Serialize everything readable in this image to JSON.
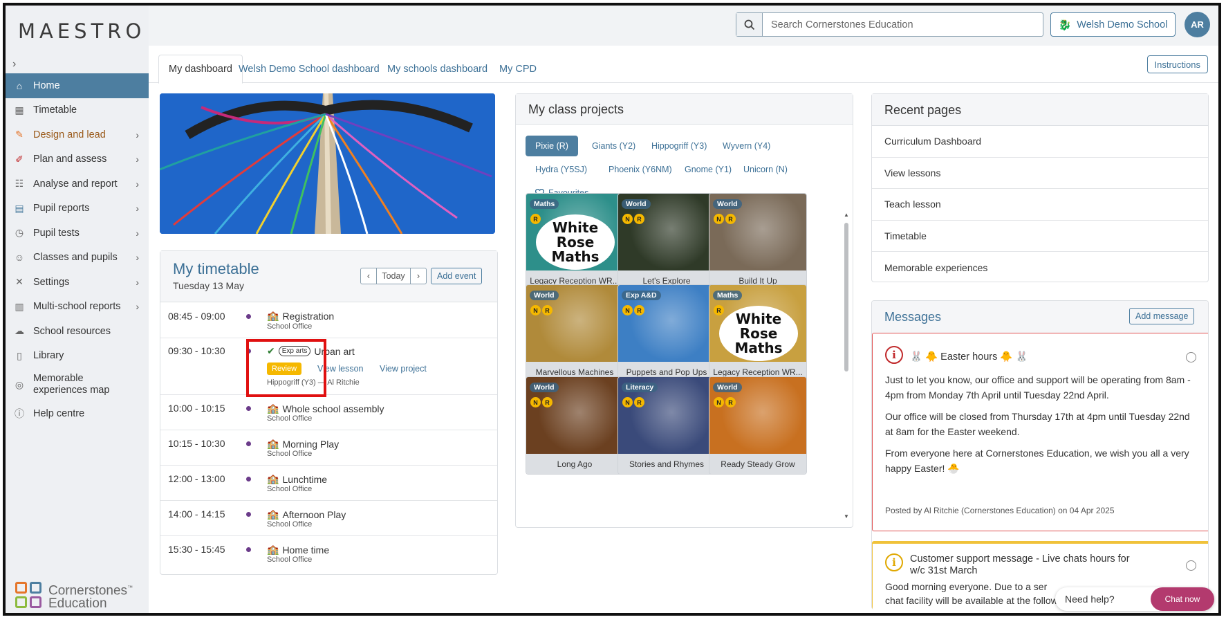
{
  "app": {
    "logo": "MAESTRO",
    "collapse_glyph": "›"
  },
  "sidebar": {
    "items": [
      {
        "label": "Home",
        "icon": "home-icon",
        "glyph": "⌂",
        "active": true,
        "chevron": false
      },
      {
        "label": "Timetable",
        "icon": "calendar-icon",
        "glyph": "▦",
        "chevron": false
      },
      {
        "label": "Design and lead",
        "icon": "design-icon",
        "glyph": "✎",
        "chevron": true
      },
      {
        "label": "Plan and assess",
        "icon": "pencil-icon",
        "glyph": "✐",
        "chevron": true
      },
      {
        "label": "Analyse and report",
        "icon": "chart-icon",
        "glyph": "☷",
        "chevron": true
      },
      {
        "label": "Pupil reports",
        "icon": "report-icon",
        "glyph": "▤",
        "chevron": true
      },
      {
        "label": "Pupil tests",
        "icon": "stopwatch-icon",
        "glyph": "◷",
        "chevron": true
      },
      {
        "label": "Classes and pupils",
        "icon": "people-icon",
        "glyph": "☺",
        "chevron": true
      },
      {
        "label": "Settings",
        "icon": "tools-icon",
        "glyph": "✕",
        "chevron": true
      },
      {
        "label": "Multi-school reports",
        "icon": "buildings-icon",
        "glyph": "▥",
        "chevron": true
      },
      {
        "label": "School resources",
        "icon": "cloud-icon",
        "glyph": "☁",
        "chevron": false
      },
      {
        "label": "Library",
        "icon": "books-icon",
        "glyph": "▯",
        "chevron": false
      },
      {
        "label": "Memorable experiences map",
        "icon": "compass-icon",
        "glyph": "◎",
        "chevron": false,
        "two_line": true
      },
      {
        "label": "Help centre",
        "icon": "info-icon",
        "glyph": "ⓘ",
        "chevron": false
      }
    ],
    "brand_line1": "Cornerstones",
    "brand_line2": "Education",
    "brand_tm": "™"
  },
  "topbar": {
    "search_placeholder": "Search Cornerstones Education",
    "school_label": "Welsh Demo School",
    "avatar_initials": "AR"
  },
  "tabs": {
    "items": [
      "My dashboard",
      "Welsh Demo School dashboard",
      "My schools dashboard",
      "My CPD"
    ],
    "instructions": "Instructions"
  },
  "timetable": {
    "title": "My timetable",
    "date": "Tuesday 13 May",
    "today": "Today",
    "prev": "‹",
    "next": "›",
    "add_event": "Add event",
    "rows": [
      {
        "time": "08:45 - 09:00",
        "event": "Registration",
        "sub": "School Office"
      },
      {
        "time": "09:30 - 10:30",
        "event": "Urban art",
        "badge": "Exp arts",
        "review": "Review",
        "view_lesson": "View lesson",
        "view_project": "View project",
        "sub": "Hippogriff (Y3) — Al Ritchie"
      },
      {
        "time": "10:00 - 10:15",
        "event": "Whole school assembly",
        "sub": "School Office"
      },
      {
        "time": "10:15 - 10:30",
        "event": "Morning Play",
        "sub": "School Office"
      },
      {
        "time": "12:00 - 13:00",
        "event": "Lunchtime",
        "sub": "School Office"
      },
      {
        "time": "14:00 - 14:15",
        "event": "Afternoon Play",
        "sub": "School Office"
      },
      {
        "time": "15:30 - 15:45",
        "event": "Home time",
        "sub": "School Office"
      }
    ]
  },
  "projects": {
    "title": "My class projects",
    "classes": [
      "Pixie (R)",
      "Giants (Y2)",
      "Hippogriff (Y3)",
      "Wyvern (Y4)",
      "Hydra (Y5SJ)",
      "Phoenix (Y6NM)",
      "Gnome (Y1)",
      "Unicorn (N)"
    ],
    "favourites": "Favourites",
    "tiles": [
      {
        "subject": "Maths",
        "badges": [
          "R"
        ],
        "caption": "Legacy Reception WR...",
        "wrm": true,
        "bg": "#2d8f8a"
      },
      {
        "subject": "World",
        "badges": [
          "N",
          "R"
        ],
        "caption": "Let's Explore",
        "bg": "#2f3a28"
      },
      {
        "subject": "World",
        "badges": [
          "N",
          "R"
        ],
        "caption": "Build It Up",
        "bg": "#7a6a58"
      },
      {
        "subject": "World",
        "badges": [
          "N",
          "R"
        ],
        "caption": "Marvellous Machines",
        "bg": "#b08a3a"
      },
      {
        "subject": "Exp A&D",
        "badges": [
          "N",
          "R"
        ],
        "caption": "Puppets and Pop Ups",
        "bg": "#3d7fc4"
      },
      {
        "subject": "Maths",
        "badges": [
          "R"
        ],
        "caption": "Legacy Reception WR...",
        "wrm": true,
        "bg": "#c8a040"
      },
      {
        "subject": "World",
        "badges": [
          "N",
          "R"
        ],
        "caption": "Long Ago",
        "bg": "#6b4020"
      },
      {
        "subject": "Literacy",
        "badges": [
          "N",
          "R"
        ],
        "caption": "Stories and Rhymes",
        "bg": "#3a4a7a"
      },
      {
        "subject": "World",
        "badges": [
          "N",
          "R"
        ],
        "caption": "Ready Steady Grow",
        "bg": "#c87020"
      }
    ],
    "wrm_line1": "White",
    "wrm_line2": "Rose",
    "wrm_line3": "Maths"
  },
  "recent": {
    "title": "Recent pages",
    "items": [
      "Curriculum Dashboard",
      "View lessons",
      "Teach lesson",
      "Timetable",
      "Memorable experiences"
    ]
  },
  "messages": {
    "title": "Messages",
    "add": "Add message",
    "m1": {
      "title": "🐰 🐥 Easter hours 🐥 🐰",
      "p1": "Just to let you know, our office and support will be operating from 8am - 4pm from Monday 7th April until Tuesday 22nd April.",
      "p2": "Our office will be closed from Thursday 17th at 4pm until Tuesday 22nd at 8am for the Easter weekend.",
      "p3": "From everyone here at Cornerstones Education, we wish you all a very happy Easter! 🐣",
      "posted": "Posted by Al Ritchie (Cornerstones Education) on 04 Apr 2025"
    },
    "m2": {
      "title": "Customer support message - Live chats hours for w/c 31st March",
      "p1": "Good morning everyone. Due to a ser",
      "p2": "chat facility will be available at the following times"
    }
  },
  "chat": {
    "need_help": "Need help?",
    "chat_now": "Chat now"
  },
  "colors": {
    "accent": "#4d7ea0",
    "link": "#3c7096",
    "review": "#f5b800",
    "alert": "#e01010",
    "chat": "#b33a6e"
  }
}
